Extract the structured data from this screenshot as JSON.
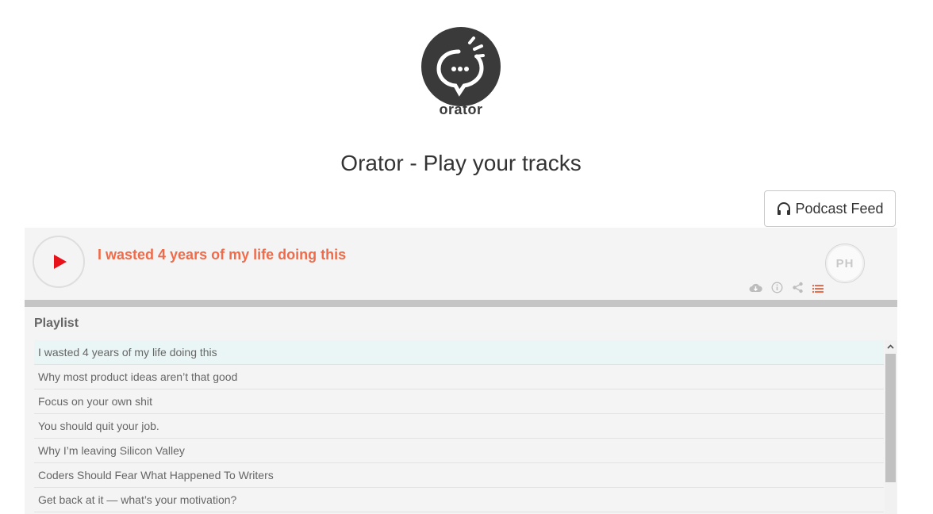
{
  "logo": {
    "wordmark": "orator"
  },
  "header": {
    "title": "Orator - Play your tracks"
  },
  "feed_button": {
    "label": "Podcast Feed"
  },
  "player": {
    "current_track": "I wasted 4 years of my life doing this",
    "avatar_text": "PH",
    "accent_color": "#ef6b4a",
    "play_color": "#e8121b",
    "progress": 0
  },
  "playlist": {
    "heading": "Playlist",
    "items": [
      "I wasted 4 years of my life doing this",
      "Why most product ideas aren’t that good",
      "Focus on your own shit",
      "You should quit your job.",
      "Why I’m leaving Silicon Valley",
      "Coders Should Fear What Happened To Writers",
      "Get back at it — what’s your motivation?"
    ]
  }
}
